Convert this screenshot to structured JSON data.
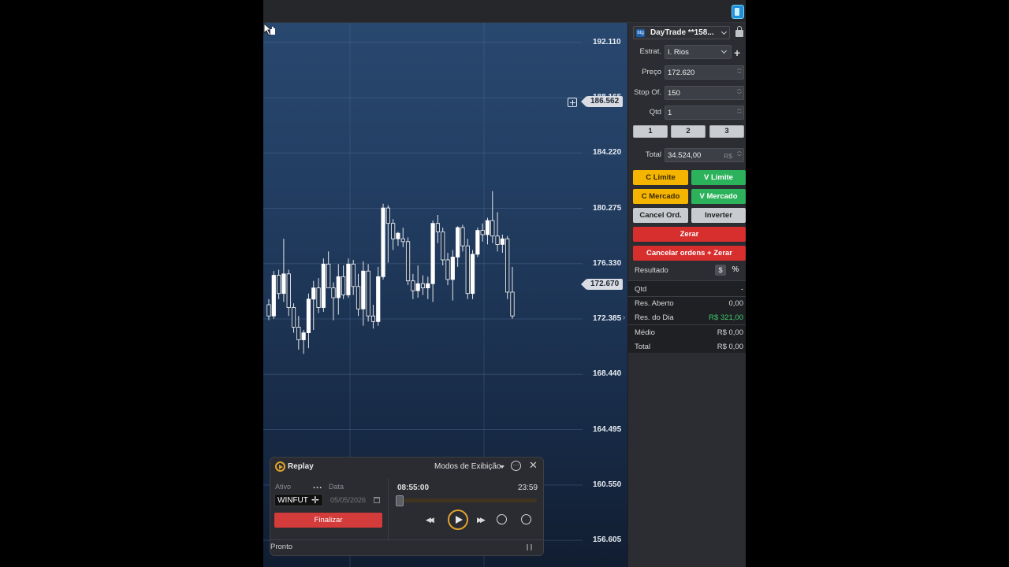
{
  "account": {
    "name": "DayTrade **158...",
    "logo_text": "btg"
  },
  "form": {
    "estrat_label": "Estrat.",
    "estrat_value": "I. Rios",
    "preco_label": "Preço",
    "preco_value": "172.620",
    "stop_label": "Stop Of.",
    "stop_value": "150",
    "qtd_label": "Qtd",
    "qtd_value": "1",
    "quick_qty": [
      "1",
      "2",
      "3"
    ],
    "total_label": "Total",
    "total_value": "34.524,00",
    "total_currency": "R$"
  },
  "actions": {
    "c_limite": "C Limite",
    "v_limite": "V Limite",
    "c_mercado": "C Mercado",
    "v_mercado": "V Mercado",
    "cancel_ord": "Cancel Ord.",
    "inverter": "Inverter",
    "zerar": "Zerar",
    "cancelar_zerar": "Cancelar ordens + Zerar"
  },
  "result": {
    "label": "Resultado",
    "dollar": "$",
    "percent": "%",
    "rows": [
      {
        "label": "Qtd",
        "value": "-"
      },
      {
        "label": "Res. Aberto",
        "value": "0,00"
      },
      {
        "label": "Res. do Dia",
        "value": "R$ 321,00"
      },
      {
        "label": "Médio",
        "value": "R$ 0,00"
      },
      {
        "label": "Total",
        "value": "R$ 0,00"
      }
    ]
  },
  "chart": {
    "price_levels": [
      "192.110",
      "188.165",
      "184.220",
      "180.275",
      "176.330",
      "172.385",
      "168.440",
      "164.495",
      "160.550",
      "156.605"
    ],
    "cursor_price": "186.562",
    "last_price": "172.670",
    "colors": {
      "up": "#ffffff",
      "down": "#ffffff",
      "wick": "#e6e6e6",
      "grid": "#5b7aa0"
    }
  },
  "chart_data": {
    "type": "candlestick",
    "ylim": [
      154.7,
      193.5
    ],
    "candles": [
      [
        173.4,
        173.8,
        172.3,
        172.6
      ],
      [
        172.6,
        175.8,
        172.4,
        175.5
      ],
      [
        175.5,
        175.9,
        173.8,
        174.2
      ],
      [
        174.2,
        178.1,
        173.6,
        175.6
      ],
      [
        175.6,
        175.9,
        172.6,
        173.2
      ],
      [
        173.2,
        173.5,
        171.4,
        171.8
      ],
      [
        171.8,
        172.6,
        170.2,
        170.9
      ],
      [
        170.9,
        171.6,
        169.9,
        171.4
      ],
      [
        171.4,
        174.2,
        170.3,
        173.8
      ],
      [
        173.8,
        175.1,
        171.6,
        174.6
      ],
      [
        174.6,
        175.3,
        172.8,
        173.2
      ],
      [
        173.2,
        176.7,
        172.9,
        176.3
      ],
      [
        176.3,
        177.2,
        174.6,
        174.6
      ],
      [
        174.6,
        175.0,
        172.3,
        173.9
      ],
      [
        173.9,
        176.3,
        172.7,
        175.4
      ],
      [
        175.4,
        176.2,
        173.8,
        174.1
      ],
      [
        174.1,
        176.7,
        173.9,
        176.3
      ],
      [
        176.3,
        176.6,
        174.1,
        174.7
      ],
      [
        174.7,
        175.6,
        172.6,
        173.1
      ],
      [
        173.1,
        176.5,
        171.9,
        175.8
      ],
      [
        175.8,
        176.3,
        172.2,
        172.6
      ],
      [
        172.6,
        173.4,
        171.7,
        172.2
      ],
      [
        172.2,
        176.1,
        171.9,
        175.4
      ],
      [
        175.4,
        180.6,
        175.2,
        180.3
      ],
      [
        180.3,
        180.5,
        176.4,
        179.2
      ],
      [
        179.2,
        179.5,
        177.3,
        178.1
      ],
      [
        178.1,
        178.6,
        177.6,
        178.5
      ],
      [
        178.1,
        178.9,
        177.5,
        177.9
      ],
      [
        177.9,
        178.2,
        174.8,
        175.1
      ],
      [
        175.1,
        175.6,
        173.8,
        174.4
      ],
      [
        174.4,
        176.2,
        173.9,
        174.9
      ],
      [
        174.9,
        175.5,
        174.1,
        174.6
      ],
      [
        174.6,
        175.4,
        173.8,
        174.9
      ],
      [
        174.9,
        179.4,
        173.6,
        179.2
      ],
      [
        179.2,
        179.8,
        177.8,
        178.6
      ],
      [
        178.6,
        178.9,
        176.2,
        176.6
      ],
      [
        176.6,
        177.1,
        174.8,
        175.2
      ],
      [
        175.2,
        177.3,
        173.7,
        176.8
      ],
      [
        176.8,
        179.0,
        176.1,
        178.9
      ],
      [
        178.9,
        179.1,
        177.2,
        177.6
      ],
      [
        177.6,
        178.1,
        173.8,
        174.2
      ],
      [
        174.2,
        177.3,
        173.8,
        177.0
      ],
      [
        177.0,
        178.9,
        176.8,
        178.7
      ],
      [
        178.7,
        179.2,
        177.9,
        178.4
      ],
      [
        178.4,
        179.6,
        177.7,
        179.4
      ],
      [
        179.4,
        181.5,
        177.8,
        178.3
      ],
      [
        178.3,
        180.0,
        177.2,
        177.7
      ],
      [
        177.7,
        178.4,
        177.1,
        178.1
      ],
      [
        178.1,
        178.3,
        173.8,
        174.3
      ],
      [
        174.3,
        176.1,
        172.4,
        172.6
      ]
    ]
  },
  "replay": {
    "title": "Replay",
    "modes": "Modos de Exibição",
    "ativo_label": "Ativo",
    "ativo_value": "WINFUT",
    "data_label": "Data",
    "data_value": "05/05/2026",
    "finalizar": "Finalizar",
    "time_start": "08:55:00",
    "time_end": "23:59",
    "progress": 0.0,
    "status": "Pronto"
  }
}
